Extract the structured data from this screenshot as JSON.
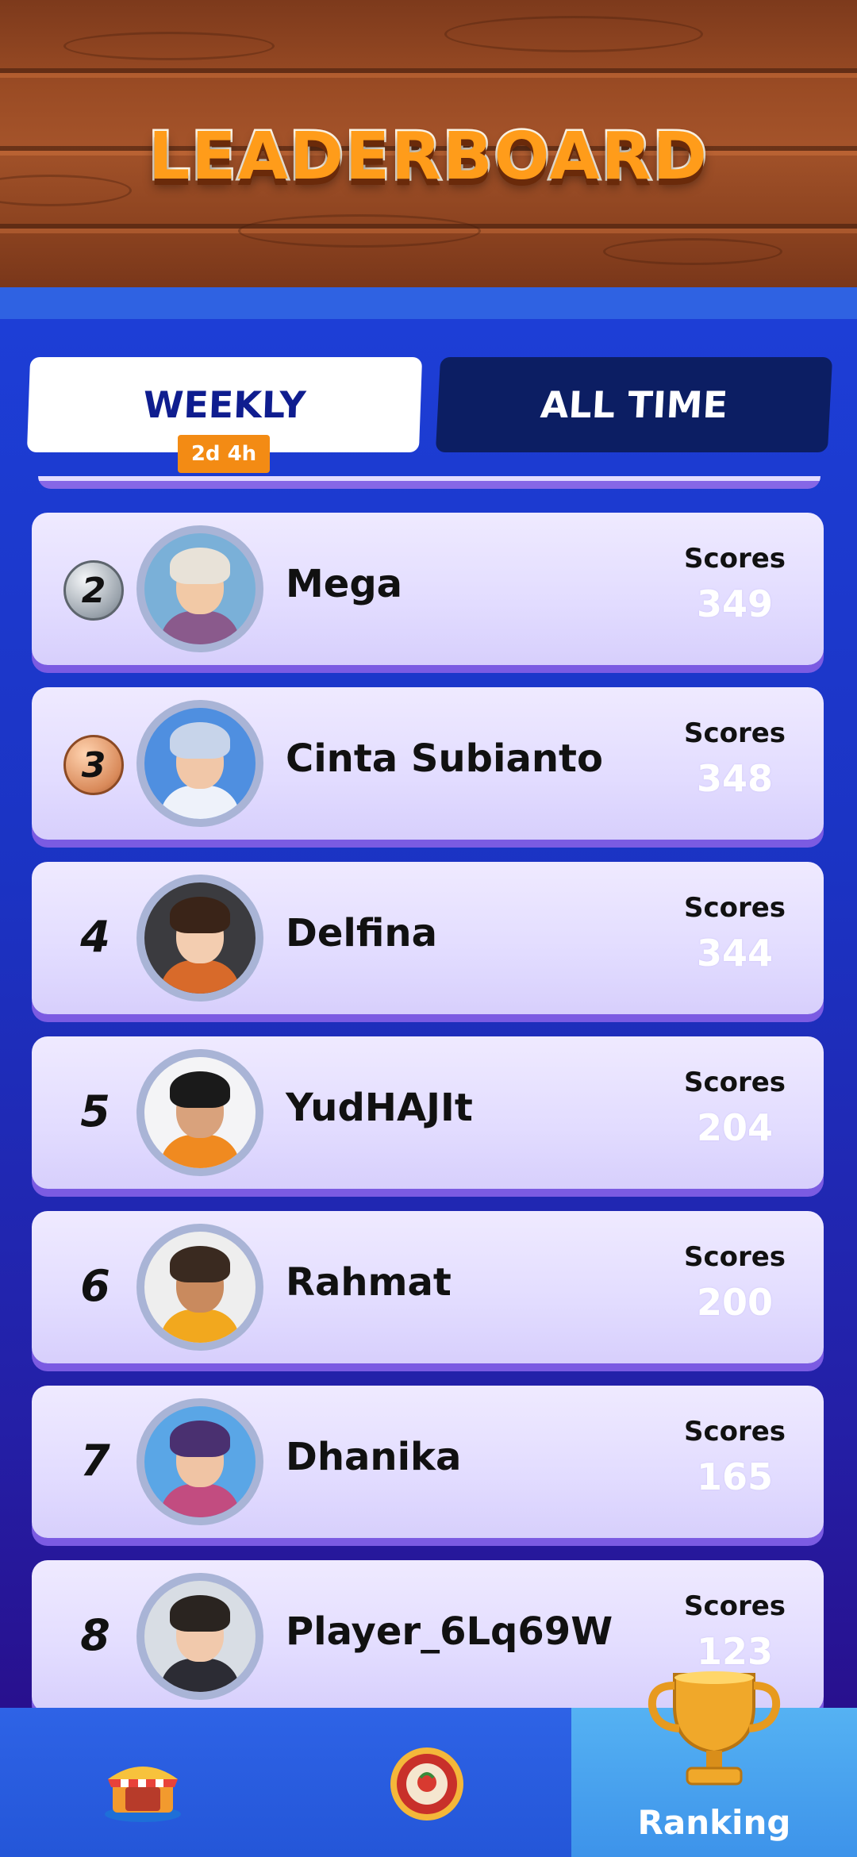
{
  "header": {
    "title": "LEADERBOARD"
  },
  "tabs": {
    "weekly": "WEEKLY",
    "all_time": "ALL TIME",
    "timer": "2d 4h"
  },
  "rows": [
    {
      "rank": "2",
      "medal": "silver",
      "name": "Mega",
      "score_label": "Scores",
      "score": "349"
    },
    {
      "rank": "3",
      "medal": "bronze",
      "name": "Cinta Subianto",
      "score_label": "Scores",
      "score": "348"
    },
    {
      "rank": "4",
      "name": "Delfina",
      "score_label": "Scores",
      "score": "344"
    },
    {
      "rank": "5",
      "name": "YudHAJIt",
      "score_label": "Scores",
      "score": "204"
    },
    {
      "rank": "6",
      "name": "Rahmat",
      "score_label": "Scores",
      "score": "200"
    },
    {
      "rank": "7",
      "name": "Dhanika",
      "score_label": "Scores",
      "score": "165"
    },
    {
      "rank": "8",
      "name": "Player_6Lq69W",
      "score_label": "Scores",
      "score": "123"
    }
  ],
  "nav": {
    "items": [
      {
        "icon": "shop-icon"
      },
      {
        "icon": "pizza-icon"
      },
      {
        "icon": "trophy-icon",
        "label": "Ranking",
        "active": true
      }
    ]
  },
  "colors": {
    "accent": "#f38b14",
    "primary": "#1d3ed6",
    "card": "#e2dcff",
    "title": "#ff9c1a"
  }
}
